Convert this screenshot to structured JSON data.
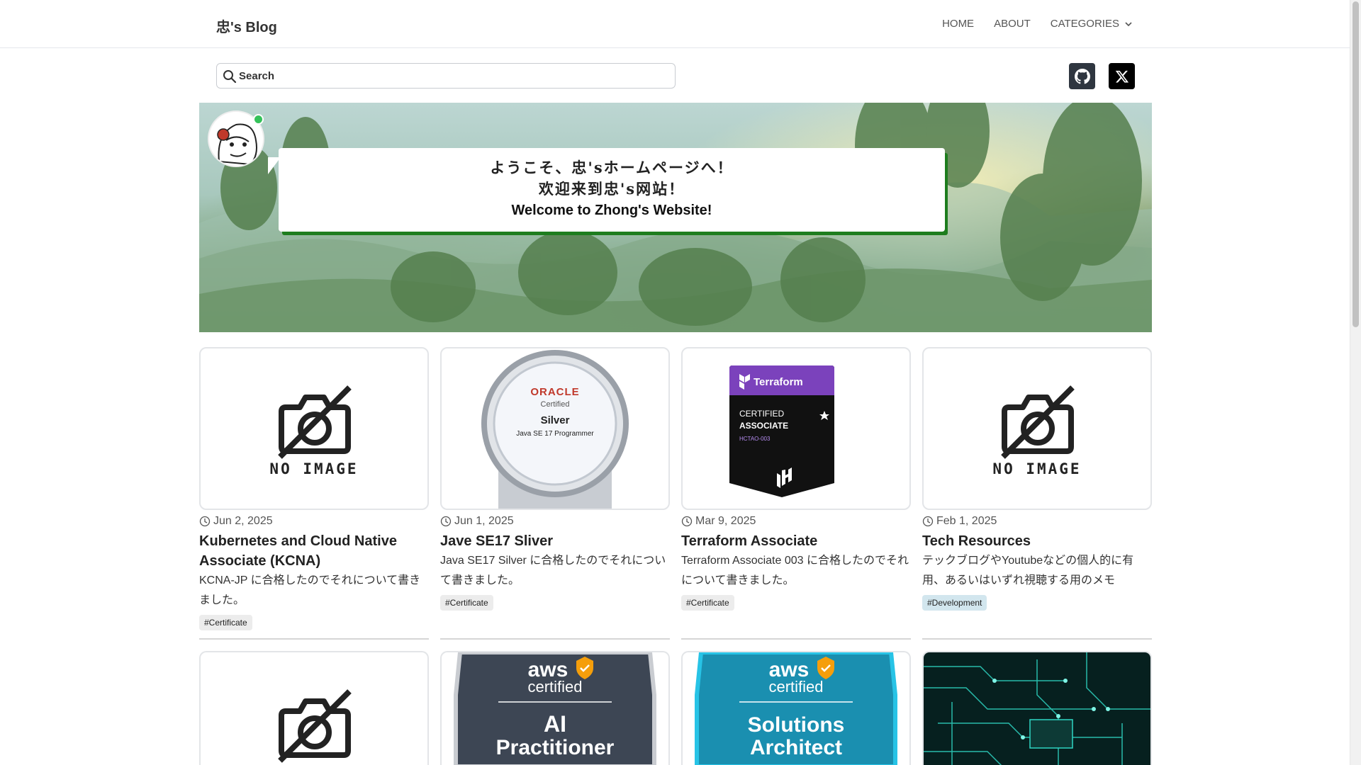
{
  "nav": {
    "brand": "忠's Blog",
    "home": "HOME",
    "about": "ABOUT",
    "categories": "CATEGORIES"
  },
  "search": {
    "placeholder": "Search"
  },
  "social": {
    "github": "github-icon",
    "x": "x-icon"
  },
  "hero": {
    "greeting_ja": "ようこそ、忠'sホームページへ！",
    "greeting_zh": "欢迎来到忠's网站！",
    "greeting_en": "Welcome to Zhong's Website!"
  },
  "no_image_label": "NO IMAGE",
  "cards": [
    {
      "date": "Jun 2, 2025",
      "title": "Kubernetes and Cloud Native Associate (KCNA)",
      "desc": "KCNA-JP に合格したのでそれについて書きました。",
      "tag": "#Certificate"
    },
    {
      "date": "Jun 1, 2025",
      "title": "Jave SE17 Sliver",
      "desc": "Java SE17 Silver に合格したのでそれについて書きました。",
      "tag": "#Certificate"
    },
    {
      "date": "Mar 9, 2025",
      "title": "Terraform Associate",
      "desc": "Terraform Associate 003 に合格したのでそれについて書きました。",
      "tag": "#Certificate"
    },
    {
      "date": "Feb 1, 2025",
      "title": "Tech Resources",
      "desc": "テックブログやYoutubeなどの個人的に有用、あるいはいずれ視聴する用のメモ",
      "tag": "#Development"
    }
  ],
  "badges": {
    "oracle": {
      "brand": "ORACLE",
      "sub": "Certified",
      "level": "Silver",
      "name": "Java SE 17 Programmer"
    },
    "terraform": {
      "brand": "Terraform",
      "line1": "CERTIFIED",
      "line2": "ASSOCIATE",
      "code": "HCTAO-003"
    },
    "aws_ai": {
      "brand": "aws",
      "sub": "certified",
      "line1": "AI",
      "line2": "Practitioner"
    },
    "aws_sa": {
      "brand": "aws",
      "sub": "certified",
      "line1": "Solutions",
      "line2": "Architect"
    }
  },
  "colors": {
    "accent_green": "#1e7d1e",
    "online": "#35c25a",
    "terraform_purple": "#7b42bc",
    "aws_sa_blue": "#1aa7c9",
    "aws_ai_slate": "#3d4654"
  }
}
